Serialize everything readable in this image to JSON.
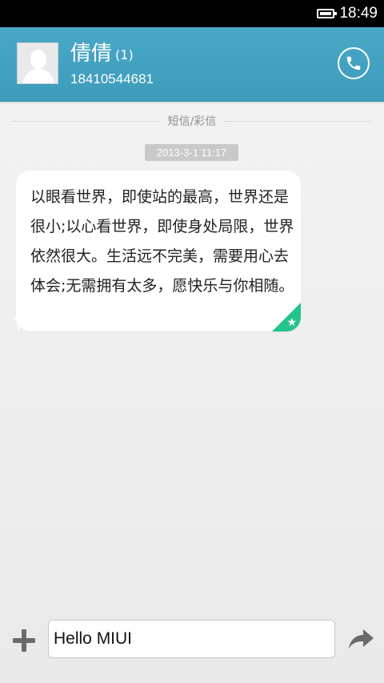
{
  "status_bar": {
    "time": "18:49"
  },
  "header": {
    "contact_name": "倩倩",
    "message_count": "(1)",
    "phone_number": "18410544681"
  },
  "conversation": {
    "divider_label": "短信/彩信",
    "timestamp": "2013-3-1 11:17",
    "message_text": "以眼看世界，即使站的最高，世界还是很小;以心看世界，即使身处局限，世界依然很大。生活远不完美，需要用心去体会;无需拥有太多，愿快乐与你相随。"
  },
  "composer": {
    "input_value": "Hello MIUI"
  },
  "colors": {
    "header_bg": "#3d9bbb",
    "star_badge": "#23c48a"
  }
}
